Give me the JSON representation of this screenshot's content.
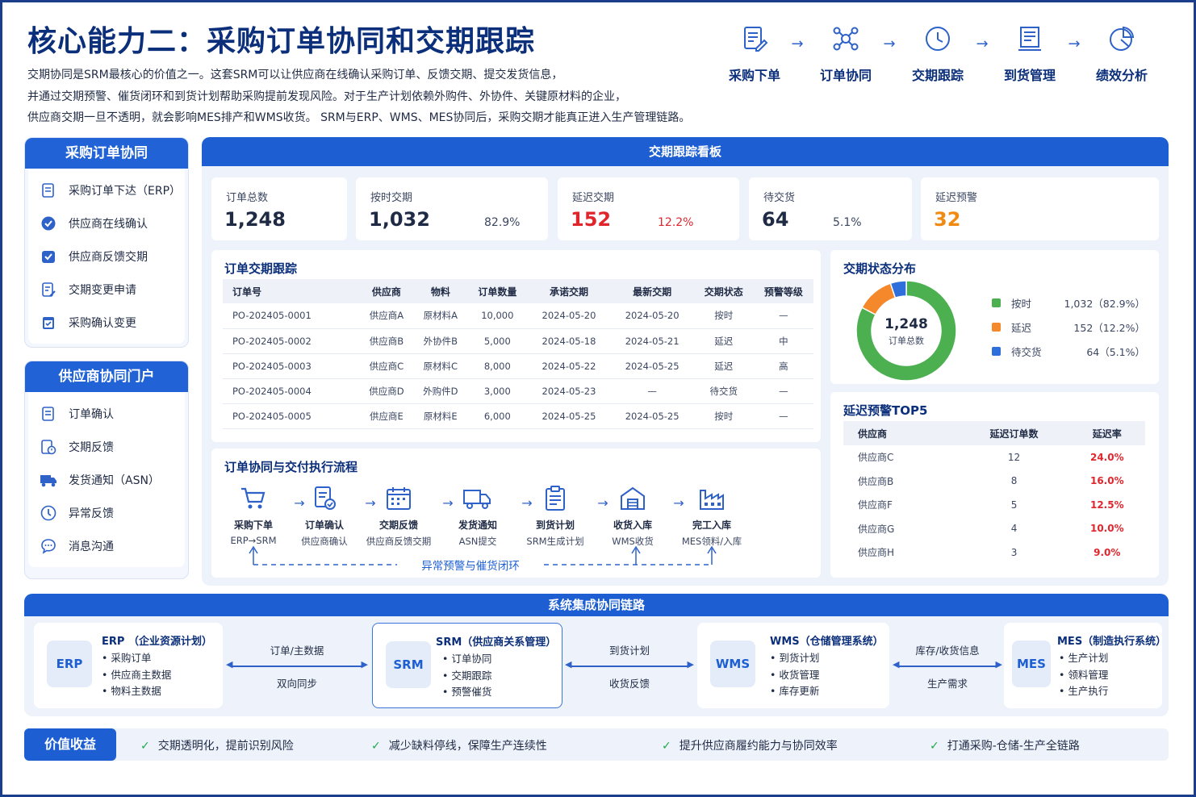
{
  "header": {
    "title": "核心能力二：采购订单协同和交期跟踪",
    "intro": [
      "交期协同是SRM最核心的价值之一。这套SRM可以让供应商在线确认采购订单、反馈交期、提交发货信息，",
      "并通过交期预警、催货闭环和到货计划帮助采购提前发现风险。对于生产计划依赖外购件、外协件、关键原材料的企业，",
      "供应商交期一旦不透明，就会影响MES排产和WMS收货。 SRM与ERP、WMS、MES协同后，采购交期才能真正进入生产管理链路。"
    ],
    "flow": [
      {
        "label": "采购下单",
        "icon": "document-edit-icon"
      },
      {
        "label": "订单协同",
        "icon": "network-icon"
      },
      {
        "label": "交期跟踪",
        "icon": "clock-icon"
      },
      {
        "label": "到货管理",
        "icon": "receipt-icon"
      },
      {
        "label": "绩效分析",
        "icon": "pie-chart-icon"
      }
    ],
    "arrow": "→"
  },
  "po_panel": {
    "title": "采购订单协同",
    "items": [
      {
        "label": "采购订单下达（ERP）",
        "icon": "document-icon"
      },
      {
        "label": "供应商在线确认",
        "icon": "check-circle-icon"
      },
      {
        "label": "供应商反馈交期",
        "icon": "shield-check-icon"
      },
      {
        "label": "交期变更申请",
        "icon": "document-edit-icon"
      },
      {
        "label": "采购确认变更",
        "icon": "calendar-check-icon"
      }
    ]
  },
  "portal_panel": {
    "title": "供应商协同门户",
    "items": [
      {
        "label": "订单确认",
        "icon": "document-icon"
      },
      {
        "label": "交期反馈",
        "icon": "document-clock-icon"
      },
      {
        "label": "发货通知（ASN）",
        "icon": "truck-icon"
      },
      {
        "label": "异常反馈",
        "icon": "alert-circle-icon"
      },
      {
        "label": "消息沟通",
        "icon": "chat-icon"
      }
    ]
  },
  "dashboard": {
    "title": "交期跟踪看板",
    "kpis": [
      {
        "label": "订单总数",
        "value": "1,248",
        "pct": ""
      },
      {
        "label": "按时交期",
        "value": "1,032",
        "pct": "82.9%"
      },
      {
        "label": "延迟交期",
        "value": "152",
        "pct": "12.2%"
      },
      {
        "label": "待交货",
        "value": "64",
        "pct": "5.1%"
      },
      {
        "label": "延迟预警",
        "value": "32",
        "pct": ""
      }
    ],
    "colors": {
      "red": "#e0262d",
      "orange": "#f08a12",
      "green": "#1fa84b",
      "blue": "#2f62c9"
    }
  },
  "orders": {
    "title": "订单交期跟踪",
    "columns": [
      "订单号",
      "供应商",
      "物料",
      "订单数量",
      "承诺交期",
      "最新交期",
      "交期状态",
      "预警等级"
    ],
    "rows": [
      [
        "PO-202405-0001",
        "供应商A",
        "原材料A",
        "10,000",
        "2024-05-20",
        "2024-05-20",
        "按时",
        "—"
      ],
      [
        "PO-202405-0002",
        "供应商B",
        "外协件B",
        "5,000",
        "2024-05-18",
        "2024-05-21",
        "延迟",
        "中"
      ],
      [
        "PO-202405-0003",
        "供应商C",
        "原材料C",
        "8,000",
        "2024-05-22",
        "2024-05-25",
        "延迟",
        "高"
      ],
      [
        "PO-202405-0004",
        "供应商D",
        "外购件D",
        "3,000",
        "2024-05-23",
        "—",
        "待交货",
        "—"
      ],
      [
        "PO-202405-0005",
        "供应商E",
        "原材料E",
        "6,000",
        "2024-05-25",
        "2024-05-25",
        "按时",
        "—"
      ]
    ]
  },
  "process": {
    "title": "订单协同与交付执行流程",
    "steps": [
      {
        "name": "采购下单",
        "sub": "ERP→SRM",
        "icon": "cart-icon"
      },
      {
        "name": "订单确认",
        "sub": "供应商确认",
        "icon": "document-check-icon"
      },
      {
        "name": "交期反馈",
        "sub": "供应商反馈交期",
        "icon": "calendar-icon"
      },
      {
        "name": "发货通知",
        "sub": "ASN提交",
        "icon": "truck-icon"
      },
      {
        "name": "到货计划",
        "sub": "SRM生成计划",
        "icon": "clipboard-icon"
      },
      {
        "name": "收货入库",
        "sub": "WMS收货",
        "icon": "warehouse-icon"
      },
      {
        "name": "完工入库",
        "sub": "MES领料/入库",
        "icon": "factory-icon"
      }
    ],
    "loop_label": "异常预警与催货闭环"
  },
  "chart_data": {
    "type": "pie",
    "title": "交期状态分布",
    "center_value": "1,248",
    "center_label": "订单总数",
    "categories": [
      "按时",
      "延迟",
      "待交货"
    ],
    "values": [
      1032,
      152,
      64
    ],
    "display": [
      "1,032（82.9%）",
      "152（12.2%）",
      "64（5.1%）"
    ],
    "colors": [
      "#4caf50",
      "#f5882a",
      "#2f6fdc"
    ]
  },
  "top5": {
    "title": "延迟预警TOP5",
    "columns": [
      "供应商",
      "延迟订单数",
      "延迟率"
    ],
    "rows": [
      [
        "供应商C",
        "12",
        "24.0%"
      ],
      [
        "供应商B",
        "8",
        "16.0%"
      ],
      [
        "供应商F",
        "5",
        "12.5%"
      ],
      [
        "供应商G",
        "4",
        "10.0%"
      ],
      [
        "供应商H",
        "3",
        "9.0%"
      ]
    ]
  },
  "integration": {
    "title": "系统集成协同链路",
    "systems": [
      {
        "logo": "ERP",
        "title": "ERP （企业资源计划）",
        "items": [
          "• 采购订单",
          "• 供应商主数据",
          "• 物料主数据"
        ]
      },
      {
        "logo": "SRM",
        "title": "SRM（供应商关系管理）",
        "items": [
          "• 订单协同",
          "• 交期跟踪",
          "• 预警催货"
        ]
      },
      {
        "logo": "WMS",
        "title": "WMS（仓储管理系统）",
        "items": [
          "• 到货计划",
          "• 收货管理",
          "• 库存更新"
        ]
      },
      {
        "logo": "MES",
        "title": "MES（制造执行系统）",
        "items": [
          "• 生产计划",
          "• 领料管理",
          "• 生产执行"
        ]
      }
    ],
    "links": [
      {
        "top": "订单/主数据",
        "bottom": "双向同步"
      },
      {
        "top": "到货计划",
        "bottom": "收货反馈"
      },
      {
        "top": "库存/收货信息",
        "bottom": "生产需求"
      }
    ]
  },
  "value": {
    "badge": "价值收益",
    "items": [
      "交期透明化，提前识别风险",
      "减少缺料停线，保障生产连续性",
      "提升供应商履约能力与协同效率",
      "打通采购-仓储-生产全链路"
    ],
    "check": "✓"
  }
}
